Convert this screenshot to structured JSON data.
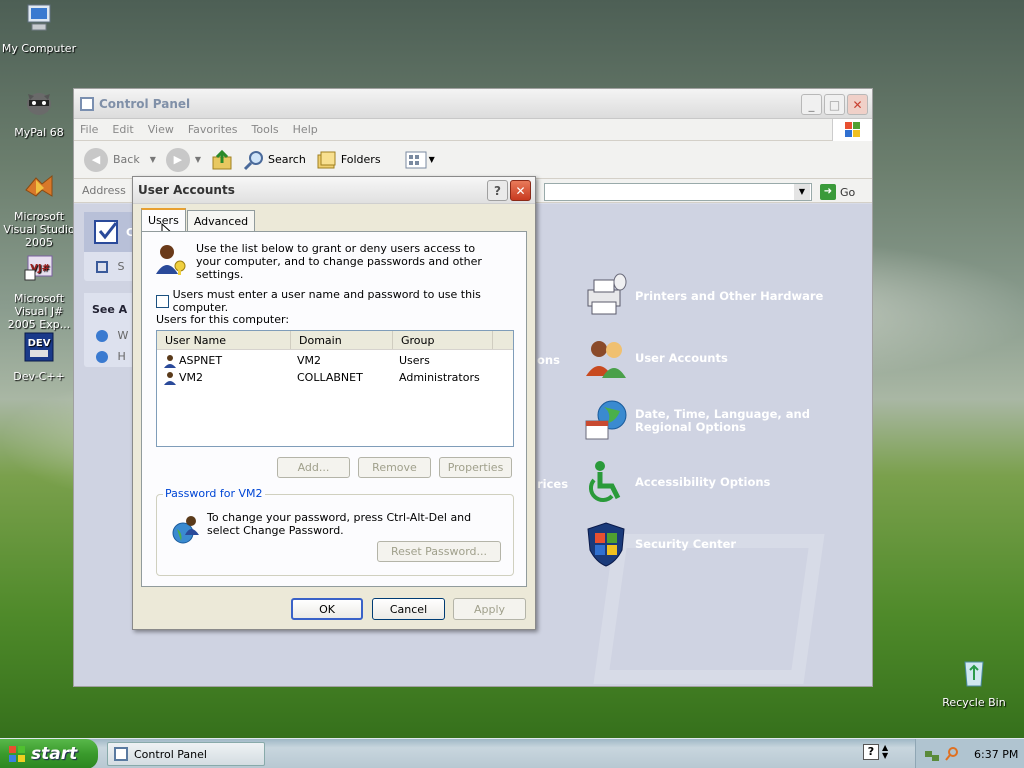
{
  "desktop": {
    "icons": [
      {
        "label": "My Computer"
      },
      {
        "label": "MyPal 68"
      },
      {
        "label": "Microsoft Visual Studio 2005"
      },
      {
        "label": "Microsoft Visual J# 2005 Exp..."
      },
      {
        "label": "Dev-C++"
      },
      {
        "label": "Recycle Bin"
      }
    ]
  },
  "control_panel": {
    "title": "Control Panel",
    "menu": [
      "File",
      "Edit",
      "View",
      "Favorites",
      "Tools",
      "Help"
    ],
    "toolbar": {
      "back": "Back",
      "search": "Search",
      "folders": "Folders"
    },
    "address_label": "Address",
    "go_label": "Go",
    "left": {
      "top_partial": "Co",
      "switch_partial": "S",
      "see_also": "See A",
      "see_item1": "W",
      "see_item2": "H"
    },
    "categories": [
      {
        "label": "Printers and Other Hardware",
        "icon": "printer-icon"
      },
      {
        "label": "User Accounts",
        "icon": "users-icon"
      },
      {
        "label": "Date, Time, Language, and Regional Options",
        "icon": "globe-calendar-icon"
      },
      {
        "label": "Accessibility Options",
        "icon": "accessibility-icon"
      },
      {
        "label": "Security Center",
        "icon": "shield-icon"
      }
    ],
    "partials": [
      "ons",
      "rices"
    ]
  },
  "dialog": {
    "title": "User Accounts",
    "tabs": [
      "Users",
      "Advanced"
    ],
    "intro_text": "Use the list below to grant or deny users access to your computer, and to change passwords and other settings.",
    "checkbox_label": "Users must enter a user name and password to use this computer.",
    "checkbox_checked": false,
    "users_label": "Users for this computer:",
    "columns": [
      "User Name",
      "Domain",
      "Group"
    ],
    "rows": [
      {
        "name": "ASPNET",
        "domain": "VM2",
        "group": "Users"
      },
      {
        "name": "VM2",
        "domain": "COLLABNET",
        "group": "Administrators"
      }
    ],
    "buttons": {
      "add": "Add...",
      "remove": "Remove",
      "properties": "Properties"
    },
    "password_group": {
      "title": "Password for VM2",
      "text": "To change your password, press Ctrl-Alt-Del and select Change Password.",
      "reset": "Reset Password..."
    },
    "footer": {
      "ok": "OK",
      "cancel": "Cancel",
      "apply": "Apply"
    }
  },
  "taskbar": {
    "start": "start",
    "task": "Control Panel",
    "clock": "6:37 PM"
  }
}
